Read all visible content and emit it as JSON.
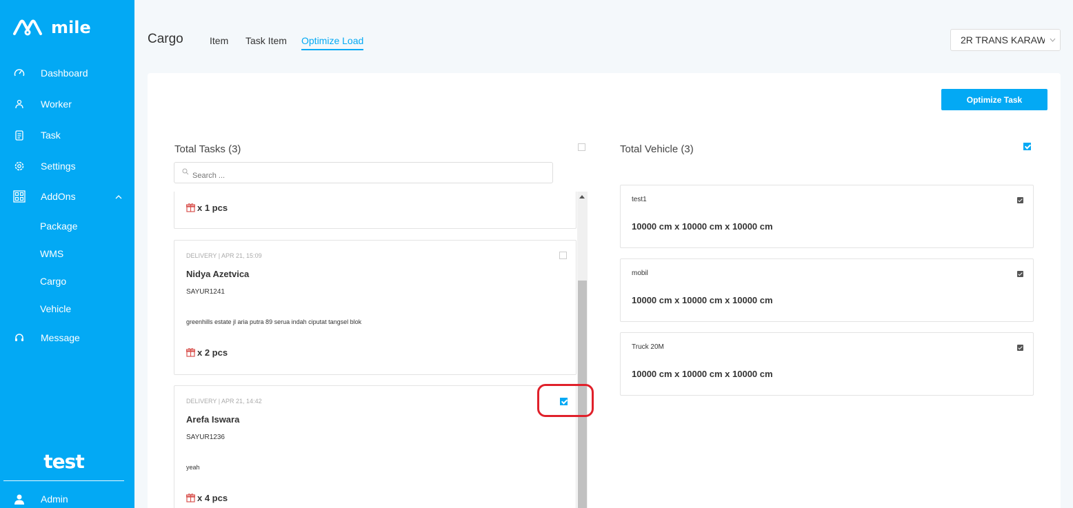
{
  "app": {
    "name": "mile",
    "brand_bottom": "test"
  },
  "sidebar": {
    "items": [
      {
        "label": "Dashboard",
        "icon": "dashboard-icon"
      },
      {
        "label": "Worker",
        "icon": "worker-icon"
      },
      {
        "label": "Task",
        "icon": "task-icon"
      },
      {
        "label": "Settings",
        "icon": "gear-icon"
      },
      {
        "label": "AddOns",
        "icon": "addons-icon"
      },
      {
        "label": "Message",
        "icon": "headset-icon"
      }
    ],
    "addons_sub": [
      "Package",
      "WMS",
      "Cargo",
      "Vehicle"
    ],
    "user": "Admin"
  },
  "header": {
    "title": "Cargo",
    "tabs": [
      "Item",
      "Task Item",
      "Optimize Load"
    ],
    "active_tab": "Optimize Load",
    "org_select": "2R TRANS KARAWANG"
  },
  "main": {
    "optimize_label": "Optimize Task",
    "tasks_title": "Total Tasks (3)",
    "vehicles_title": "Total Vehicle (3)",
    "search_placeholder": "Search ...",
    "tasks": [
      {
        "qty": "x 1 pcs"
      },
      {
        "meta": "DELIVERY | APR 21, 15:09",
        "name": "Nidya Azetvica",
        "code": "SAYUR1241",
        "address": "greenhills estate jl aria putra 89 serua indah ciputat tangsel blok",
        "qty": "x 2 pcs",
        "checked": false
      },
      {
        "meta": "DELIVERY | APR 21, 14:42",
        "name": "Arefa Iswara",
        "code": "SAYUR1236",
        "address": "yeah",
        "qty": "x 4 pcs",
        "checked": true
      }
    ],
    "vehicles": [
      {
        "name": "test1",
        "dims": "10000 cm x 10000 cm x 10000 cm",
        "checked": true
      },
      {
        "name": "mobil",
        "dims": "10000 cm x 10000 cm x 10000 cm",
        "checked": true
      },
      {
        "name": "Truck 20M",
        "dims": "10000 cm x 10000 cm x 10000 cm",
        "checked": true
      }
    ]
  },
  "colors": {
    "accent": "#03a9f4",
    "highlight": "#e0202a",
    "package_icon": "#d9534f"
  }
}
